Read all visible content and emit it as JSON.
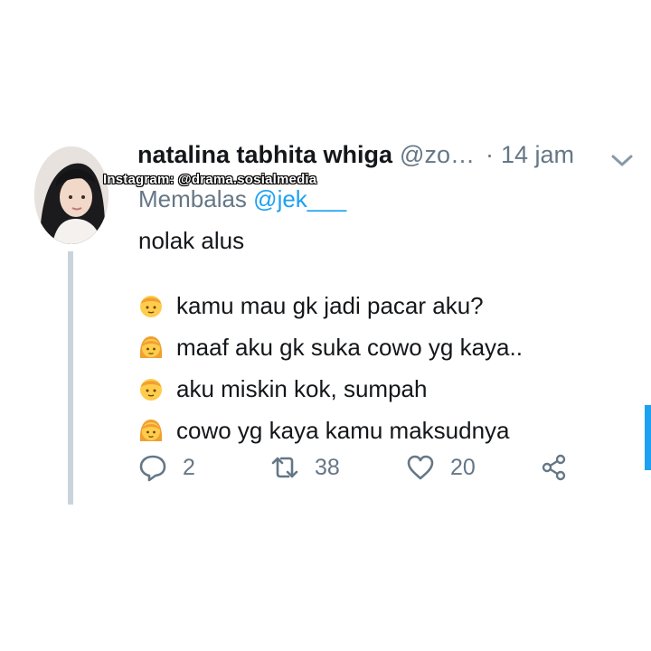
{
  "tweet": {
    "display_name": "natalina tabhita whiga",
    "handle": "@zo…",
    "separator": "·",
    "time": "14 jam",
    "replying_prefix": "Membalas",
    "replying_to": "@jek___",
    "text_first": "nolak alus",
    "lines": [
      {
        "speaker": "boy-emoji",
        "text": "kamu mau gk jadi pacar aku?"
      },
      {
        "speaker": "girl-emoji",
        "text": "maaf aku gk suka cowo yg kaya.."
      },
      {
        "speaker": "boy-emoji",
        "text": "aku miskin kok, sumpah"
      },
      {
        "speaker": "girl-emoji",
        "text": "cowo yg kaya kamu maksudnya"
      }
    ],
    "reply_count": "2",
    "retweet_count": "38",
    "like_count": "20"
  },
  "watermark": "Instagram: @drama.sosialmedia",
  "colors": {
    "accent": "#1da1f2",
    "muted": "#657786",
    "text": "#14171a",
    "thread_line": "#c9d3db"
  },
  "icons": [
    "chevron-down-icon",
    "reply-icon",
    "retweet-icon",
    "heart-icon",
    "share-icon"
  ]
}
